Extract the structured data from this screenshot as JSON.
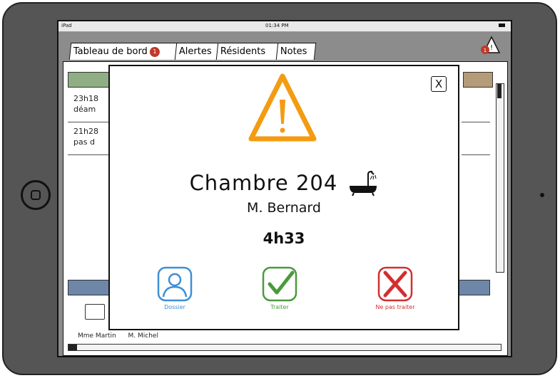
{
  "status_bar": {
    "device": "iPad",
    "time": "01:34 PM"
  },
  "tabs": [
    {
      "label": "Tableau de bord",
      "badge": "1"
    },
    {
      "label": "Alertes"
    },
    {
      "label": "Résidents"
    },
    {
      "label": "Notes"
    }
  ],
  "header": {
    "alert_badge": "1"
  },
  "background_list": {
    "rows": [
      {
        "time": "23h18",
        "text": "déam"
      },
      {
        "time": "21h28",
        "text": "pas d"
      }
    ],
    "residents": [
      "Mme Martin",
      "M. Michel"
    ]
  },
  "modal": {
    "close_label": "X",
    "room": "Chambre 204",
    "resident": "M. Bernard",
    "duration": "4h33",
    "actions": {
      "dossier": "Dossier",
      "traiter": "Traiter",
      "ne_pas_traiter": "Ne pas traiter"
    }
  },
  "colors": {
    "warning": "#f39c12",
    "dossier": "#3d8fd6",
    "traiter": "#4a9a3b",
    "ne_pas_traiter": "#d32f2f"
  }
}
